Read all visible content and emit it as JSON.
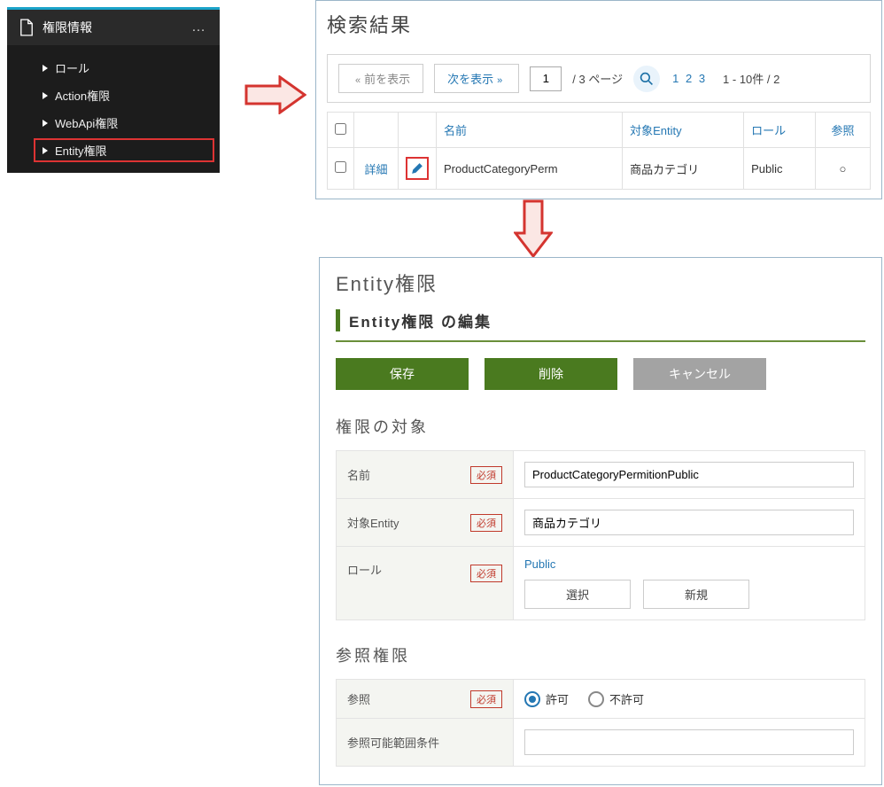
{
  "sidebar": {
    "title": "権限情報",
    "items": [
      {
        "label": "ロール"
      },
      {
        "label": "Action権限"
      },
      {
        "label": "WebApi権限"
      },
      {
        "label": "Entity権限"
      }
    ]
  },
  "search": {
    "title": "検索結果",
    "prev_btn": "前を表示",
    "next_btn": "次を表示",
    "page_input": "1",
    "total_pages": "/ 3 ページ",
    "page_links": [
      "1",
      "2",
      "3"
    ],
    "range_text": "1 - 10件 / 2",
    "headers": {
      "name": "名前",
      "entity": "対象Entity",
      "role": "ロール",
      "ref": "参照"
    },
    "row": {
      "detail": "詳細",
      "name": "ProductCategoryPerm",
      "entity": "商品カテゴリ",
      "role": "Public",
      "ref": "○"
    }
  },
  "edit": {
    "title": "Entity権限",
    "sub_title": "Entity権限 の編集",
    "buttons": {
      "save": "保存",
      "delete": "削除",
      "cancel": "キャンセル"
    },
    "required": "必須",
    "target_section": "権限の対象",
    "fields": {
      "name_label": "名前",
      "name_value": "ProductCategoryPermitionPublic",
      "entity_label": "対象Entity",
      "entity_value": "商品カテゴリ",
      "role_label": "ロール",
      "role_value": "Public",
      "select_btn": "選択",
      "new_btn": "新規"
    },
    "ref_section": "参照権限",
    "ref_label": "参照",
    "ref_allow": "許可",
    "ref_deny": "不許可",
    "ref_scope_label": "参照可能範囲条件"
  }
}
